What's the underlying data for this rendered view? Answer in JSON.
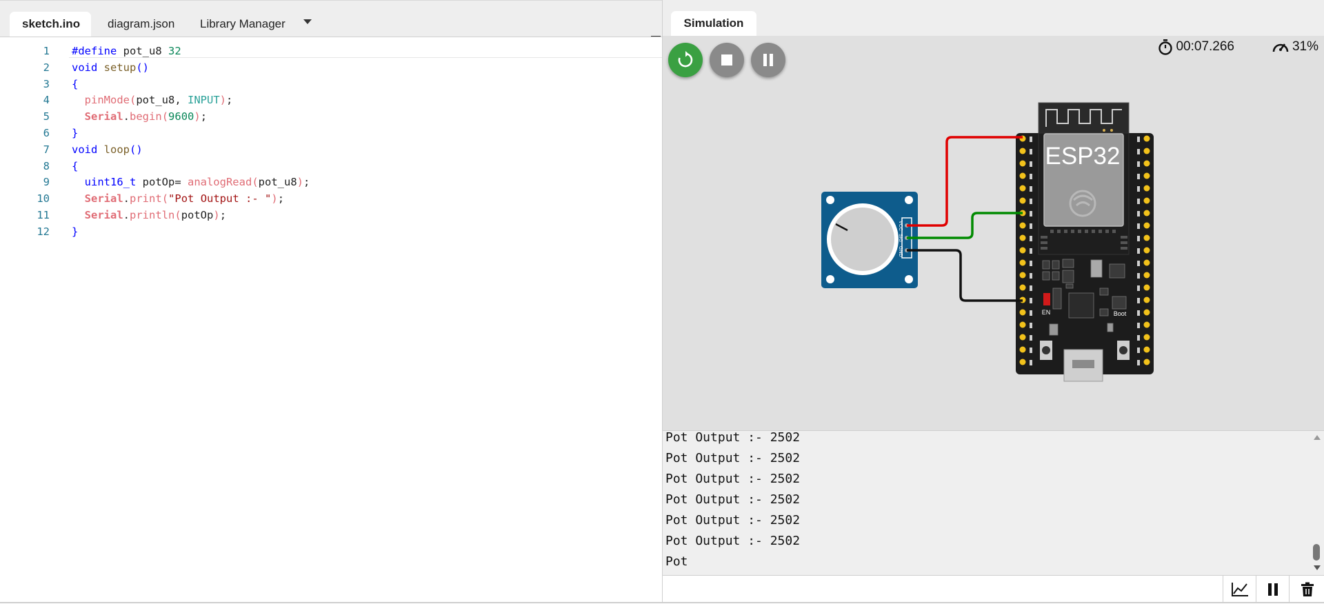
{
  "editor": {
    "tabs": [
      {
        "label": "sketch.ino"
      },
      {
        "label": "diagram.json"
      },
      {
        "label": "Library Manager"
      }
    ],
    "lines": [
      {
        "n": "1",
        "tokens": [
          [
            "k",
            "#define"
          ],
          [
            "",
            ""
          ],
          [
            "dk",
            " pot_u8 "
          ],
          [
            "c",
            "32"
          ]
        ]
      },
      {
        "n": "2",
        "tokens": [
          [
            "k",
            "void"
          ],
          [
            "dk",
            " "
          ],
          [
            "fn",
            "setup"
          ],
          [
            "k",
            "()"
          ]
        ]
      },
      {
        "n": "3",
        "tokens": [
          [
            "k",
            "{"
          ]
        ]
      },
      {
        "n": "4",
        "tokens": [
          [
            "dk",
            "  "
          ],
          [
            "f2",
            "pinMode"
          ],
          [
            "f2",
            "("
          ],
          [
            "dk",
            "pot_u8, "
          ],
          [
            "cy",
            "INPUT"
          ],
          [
            "f2",
            ")"
          ],
          [
            "dk",
            ";"
          ]
        ]
      },
      {
        "n": "5",
        "tokens": [
          [
            "dk",
            "  "
          ],
          [
            "ser",
            "Serial"
          ],
          [
            "dk",
            "."
          ],
          [
            "f2",
            "begin"
          ],
          [
            "f2",
            "("
          ],
          [
            "c",
            "9600"
          ],
          [
            "f2",
            ")"
          ],
          [
            "dk",
            ";"
          ]
        ]
      },
      {
        "n": "6",
        "tokens": [
          [
            "k",
            "}"
          ]
        ]
      },
      {
        "n": "7",
        "tokens": [
          [
            "k",
            "void"
          ],
          [
            "dk",
            " "
          ],
          [
            "fn",
            "loop"
          ],
          [
            "k",
            "()"
          ]
        ]
      },
      {
        "n": "8",
        "tokens": [
          [
            "k",
            "{"
          ]
        ]
      },
      {
        "n": "9",
        "tokens": [
          [
            "dk",
            "  "
          ],
          [
            "k",
            "uint16_t"
          ],
          [
            "dk",
            " potOp= "
          ],
          [
            "f2",
            "analogRead"
          ],
          [
            "f2",
            "("
          ],
          [
            "dk",
            "pot_u8"
          ],
          [
            "f2",
            ")"
          ],
          [
            "dk",
            ";"
          ]
        ]
      },
      {
        "n": "10",
        "tokens": [
          [
            "dk",
            "  "
          ],
          [
            "ser",
            "Serial"
          ],
          [
            "dk",
            "."
          ],
          [
            "f2",
            "print"
          ],
          [
            "f2",
            "("
          ],
          [
            "s",
            "\"Pot Output :- \""
          ],
          [
            "f2",
            ")"
          ],
          [
            "dk",
            ";"
          ]
        ]
      },
      {
        "n": "11",
        "tokens": [
          [
            "dk",
            "  "
          ],
          [
            "ser",
            "Serial"
          ],
          [
            "dk",
            "."
          ],
          [
            "f2",
            "println"
          ],
          [
            "f2",
            "("
          ],
          [
            "dk",
            "potOp"
          ],
          [
            "f2",
            ")"
          ],
          [
            "dk",
            ";"
          ]
        ]
      },
      {
        "n": "12",
        "tokens": [
          [
            "k",
            "}"
          ]
        ]
      }
    ]
  },
  "simulation": {
    "tab_label": "Simulation",
    "timer": "00:07.266",
    "speed": "31%",
    "board_label": "ESP32",
    "board_en_label": "EN",
    "board_boot_label": "Boot",
    "pot_pin_labels": [
      "VCC",
      "SIG",
      "GND"
    ],
    "wire_colors": {
      "vcc": "#e00000",
      "sig": "#008a00",
      "gnd": "#111111"
    },
    "accent_run": "#3aa042"
  },
  "serial_monitor": {
    "lines": [
      "Pot Output :- 2502",
      "Pot Output :- 2502",
      "Pot Output :- 2502",
      "Pot Output :- 2502",
      "Pot Output :- 2502",
      "Pot Output :- 2502",
      "Pot"
    ],
    "input_value": ""
  }
}
